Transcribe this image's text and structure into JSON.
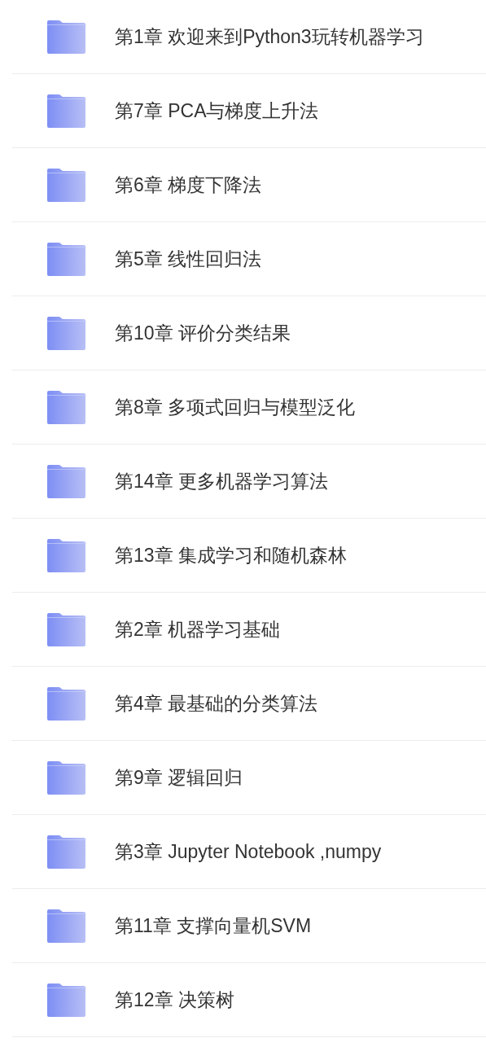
{
  "folders": [
    {
      "name": "第1章 欢迎来到Python3玩转机器学习"
    },
    {
      "name": "第7章 PCA与梯度上升法"
    },
    {
      "name": "第6章 梯度下降法"
    },
    {
      "name": "第5章 线性回归法"
    },
    {
      "name": "第10章 评价分类结果"
    },
    {
      "name": "第8章 多项式回归与模型泛化"
    },
    {
      "name": "第14章 更多机器学习算法"
    },
    {
      "name": "第13章 集成学习和随机森林"
    },
    {
      "name": "第2章 机器学习基础"
    },
    {
      "name": "第4章 最基础的分类算法"
    },
    {
      "name": "第9章 逻辑回归"
    },
    {
      "name": "第3章 Jupyter Notebook ,numpy"
    },
    {
      "name": "第11章 支撑向量机SVM"
    },
    {
      "name": "第12章 决策树"
    }
  ]
}
